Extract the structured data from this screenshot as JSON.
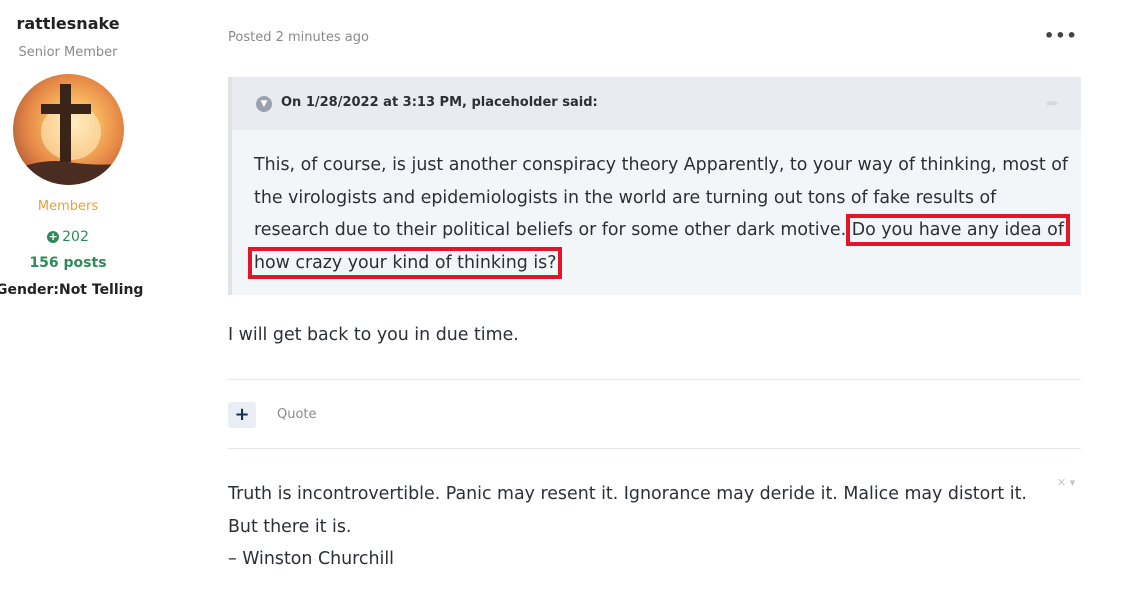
{
  "author": {
    "username": "rattlesnake",
    "rank": "Senior Member",
    "group": "Members",
    "reputation": "202",
    "posts": "156 posts",
    "gender": "Gender:Not Telling"
  },
  "post": {
    "date": "Posted 2 minutes ago",
    "more_icon": "•••",
    "quote": {
      "citation": "On 1/28/2022 at 3:13 PM, placeholder said:",
      "text_before": "This, of course, is just another conspiracy theory Apparently, to your way of thinking, most of the virologists and epidemiologists in the world are turning out tons of fake results of research due to their political beliefs or for some other dark motive.",
      "text_highlight": "Do you have any idea of how crazy your kind of thinking is?"
    },
    "reply": "I will get back to you in due time.",
    "actions": {
      "plus_label": "+",
      "quote_label": "Quote"
    }
  },
  "signature": {
    "line1": "Truth is incontrovertible. Panic may resent it. Ignorance may deride it. Malice may distort it. But there it is.",
    "line2": "– Winston Churchill",
    "controls": "✕ ▾"
  },
  "colors": {
    "accent_green": "#2e8b57",
    "group_orange": "#e8a13a",
    "highlight_red": "#e0162b",
    "quote_bg": "#f3f6f9"
  }
}
